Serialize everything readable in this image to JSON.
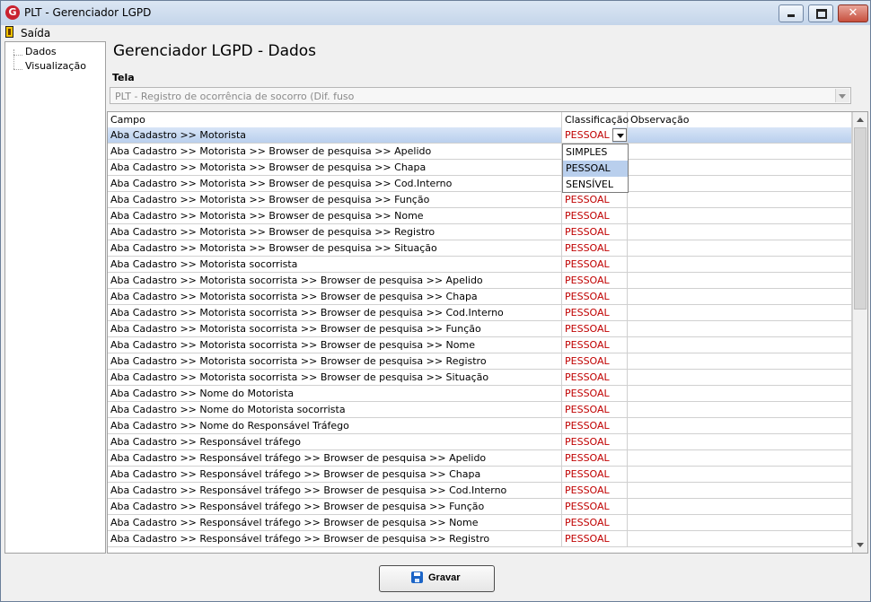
{
  "window": {
    "title": "PLT - Gerenciador LGPD",
    "icon_name": "app-logo-icon",
    "controls": [
      "minimize-icon",
      "maximize-icon",
      "close-icon"
    ],
    "close_glyph": "✕"
  },
  "menu": {
    "exit_label": "Saída",
    "exit_icon": "exit-door-icon"
  },
  "sidebar": {
    "items": [
      {
        "label": "Dados"
      },
      {
        "label": "Visualização"
      }
    ]
  },
  "page": {
    "title": "Gerenciador LGPD - Dados",
    "tela_label": "Tela",
    "tela_value": "PLT - Registro de ocorrência de socorro (Dif. fuso"
  },
  "grid": {
    "headers": [
      "Campo",
      "Classificação",
      "Observação"
    ],
    "rows": [
      {
        "campo": "Aba Cadastro >> Motorista",
        "classificacao": "PESSOAL",
        "observacao": ""
      },
      {
        "campo": "Aba Cadastro >> Motorista >> Browser de pesquisa >> Apelido",
        "classificacao": "",
        "observacao": ""
      },
      {
        "campo": "Aba Cadastro >> Motorista >> Browser de pesquisa >> Chapa",
        "classificacao": "",
        "observacao": ""
      },
      {
        "campo": "Aba Cadastro >> Motorista >> Browser de pesquisa >> Cod.Interno",
        "classificacao": "",
        "observacao": ""
      },
      {
        "campo": "Aba Cadastro >> Motorista >> Browser de pesquisa >> Função",
        "classificacao": "PESSOAL",
        "observacao": ""
      },
      {
        "campo": "Aba Cadastro >> Motorista >> Browser de pesquisa >> Nome",
        "classificacao": "PESSOAL",
        "observacao": ""
      },
      {
        "campo": "Aba Cadastro >> Motorista >> Browser de pesquisa >> Registro",
        "classificacao": "PESSOAL",
        "observacao": ""
      },
      {
        "campo": "Aba Cadastro >> Motorista >> Browser de pesquisa >> Situação",
        "classificacao": "PESSOAL",
        "observacao": ""
      },
      {
        "campo": "Aba Cadastro >> Motorista socorrista",
        "classificacao": "PESSOAL",
        "observacao": ""
      },
      {
        "campo": "Aba Cadastro >> Motorista socorrista >> Browser de pesquisa >> Apelido",
        "classificacao": "PESSOAL",
        "observacao": ""
      },
      {
        "campo": "Aba Cadastro >> Motorista socorrista >> Browser de pesquisa >> Chapa",
        "classificacao": "PESSOAL",
        "observacao": ""
      },
      {
        "campo": "Aba Cadastro >> Motorista socorrista >> Browser de pesquisa >> Cod.Interno",
        "classificacao": "PESSOAL",
        "observacao": ""
      },
      {
        "campo": "Aba Cadastro >> Motorista socorrista >> Browser de pesquisa >> Função",
        "classificacao": "PESSOAL",
        "observacao": ""
      },
      {
        "campo": "Aba Cadastro >> Motorista socorrista >> Browser de pesquisa >> Nome",
        "classificacao": "PESSOAL",
        "observacao": ""
      },
      {
        "campo": "Aba Cadastro >> Motorista socorrista >> Browser de pesquisa >> Registro",
        "classificacao": "PESSOAL",
        "observacao": ""
      },
      {
        "campo": "Aba Cadastro >> Motorista socorrista >> Browser de pesquisa >> Situação",
        "classificacao": "PESSOAL",
        "observacao": ""
      },
      {
        "campo": "Aba Cadastro >> Nome do Motorista",
        "classificacao": "PESSOAL",
        "observacao": ""
      },
      {
        "campo": "Aba Cadastro >> Nome do Motorista socorrista",
        "classificacao": "PESSOAL",
        "observacao": ""
      },
      {
        "campo": "Aba Cadastro >> Nome do Responsável Tráfego",
        "classificacao": "PESSOAL",
        "observacao": ""
      },
      {
        "campo": "Aba Cadastro >> Responsável tráfego",
        "classificacao": "PESSOAL",
        "observacao": ""
      },
      {
        "campo": "Aba Cadastro >> Responsável tráfego >> Browser de pesquisa >> Apelido",
        "classificacao": "PESSOAL",
        "observacao": ""
      },
      {
        "campo": "Aba Cadastro >> Responsável tráfego >> Browser de pesquisa >> Chapa",
        "classificacao": "PESSOAL",
        "observacao": ""
      },
      {
        "campo": "Aba Cadastro >> Responsável tráfego >> Browser de pesquisa >> Cod.Interno",
        "classificacao": "PESSOAL",
        "observacao": ""
      },
      {
        "campo": "Aba Cadastro >> Responsável tráfego >> Browser de pesquisa >> Função",
        "classificacao": "PESSOAL",
        "observacao": ""
      },
      {
        "campo": "Aba Cadastro >> Responsável tráfego >> Browser de pesquisa >> Nome",
        "classificacao": "PESSOAL",
        "observacao": ""
      },
      {
        "campo": "Aba Cadastro >> Responsável tráfego >> Browser de pesquisa >> Registro",
        "classificacao": "PESSOAL",
        "observacao": ""
      }
    ],
    "selected_row": 0,
    "dropdown_options": [
      "SIMPLES",
      "PESSOAL",
      "SENSÍVEL"
    ],
    "selected_option": "PESSOAL"
  },
  "footer": {
    "save_label": "Gravar",
    "save_icon": "save-disk-icon"
  },
  "colors": {
    "classification_red": "#c00000",
    "selection_blue": "#b9cfed"
  }
}
